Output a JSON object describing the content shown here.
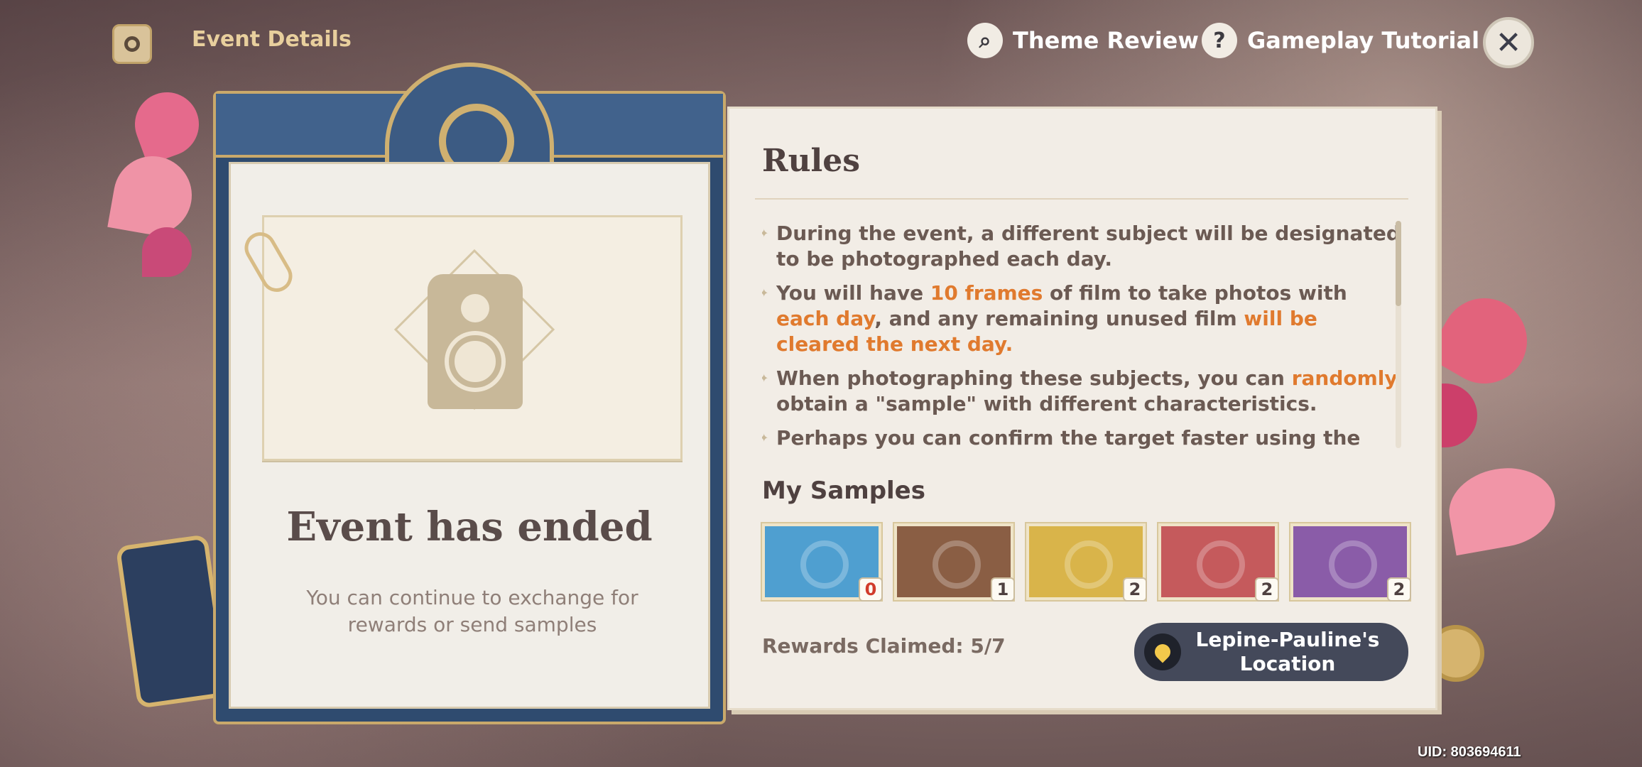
{
  "header": {
    "event_title": "Event Details",
    "theme_review": "Theme Review",
    "gameplay_tutorial": "Gameplay Tutorial",
    "search_glyph": "⌕",
    "help_glyph": "?",
    "close_glyph": "✕"
  },
  "left_card": {
    "title": "Event has ended",
    "subtitle": "You can continue to exchange for rewards or send samples"
  },
  "rules": {
    "title": "Rules",
    "items": [
      {
        "parts": [
          {
            "t": "During the event, a different subject will be designated to be photographed each day.",
            "hl": false
          }
        ]
      },
      {
        "parts": [
          {
            "t": "You will have ",
            "hl": false
          },
          {
            "t": "10 frames",
            "hl": true
          },
          {
            "t": " of film to take photos with ",
            "hl": false
          },
          {
            "t": "each day",
            "hl": true
          },
          {
            "t": ", and any remaining unused film ",
            "hl": false
          },
          {
            "t": "will be cleared the next day.",
            "hl": true
          }
        ]
      },
      {
        "parts": [
          {
            "t": "When photographing these subjects, you can ",
            "hl": false
          },
          {
            "t": "randomly",
            "hl": true
          },
          {
            "t": " obtain a \"sample\" with different characteristics.",
            "hl": false
          }
        ]
      },
      {
        "parts": [
          {
            "t": "Perhaps you can confirm the target faster using the",
            "hl": false
          }
        ]
      }
    ]
  },
  "samples": {
    "title": "My Samples",
    "items": [
      {
        "color": "#4f9fd0",
        "count": "0"
      },
      {
        "color": "#8a5e44",
        "count": "1"
      },
      {
        "color": "#d9b44a",
        "count": "2"
      },
      {
        "color": "#c55a5c",
        "count": "2"
      },
      {
        "color": "#8a5ca8",
        "count": "2"
      }
    ]
  },
  "footer": {
    "rewards_claimed": "Rewards Claimed: 5/7",
    "location_button": "Lepine-Pauline's Location"
  },
  "uid": "UID: 803694611",
  "colors": {
    "highlight": "#e07a2e",
    "card_blue": "#2f4b6f",
    "gold": "#c9a96b"
  }
}
